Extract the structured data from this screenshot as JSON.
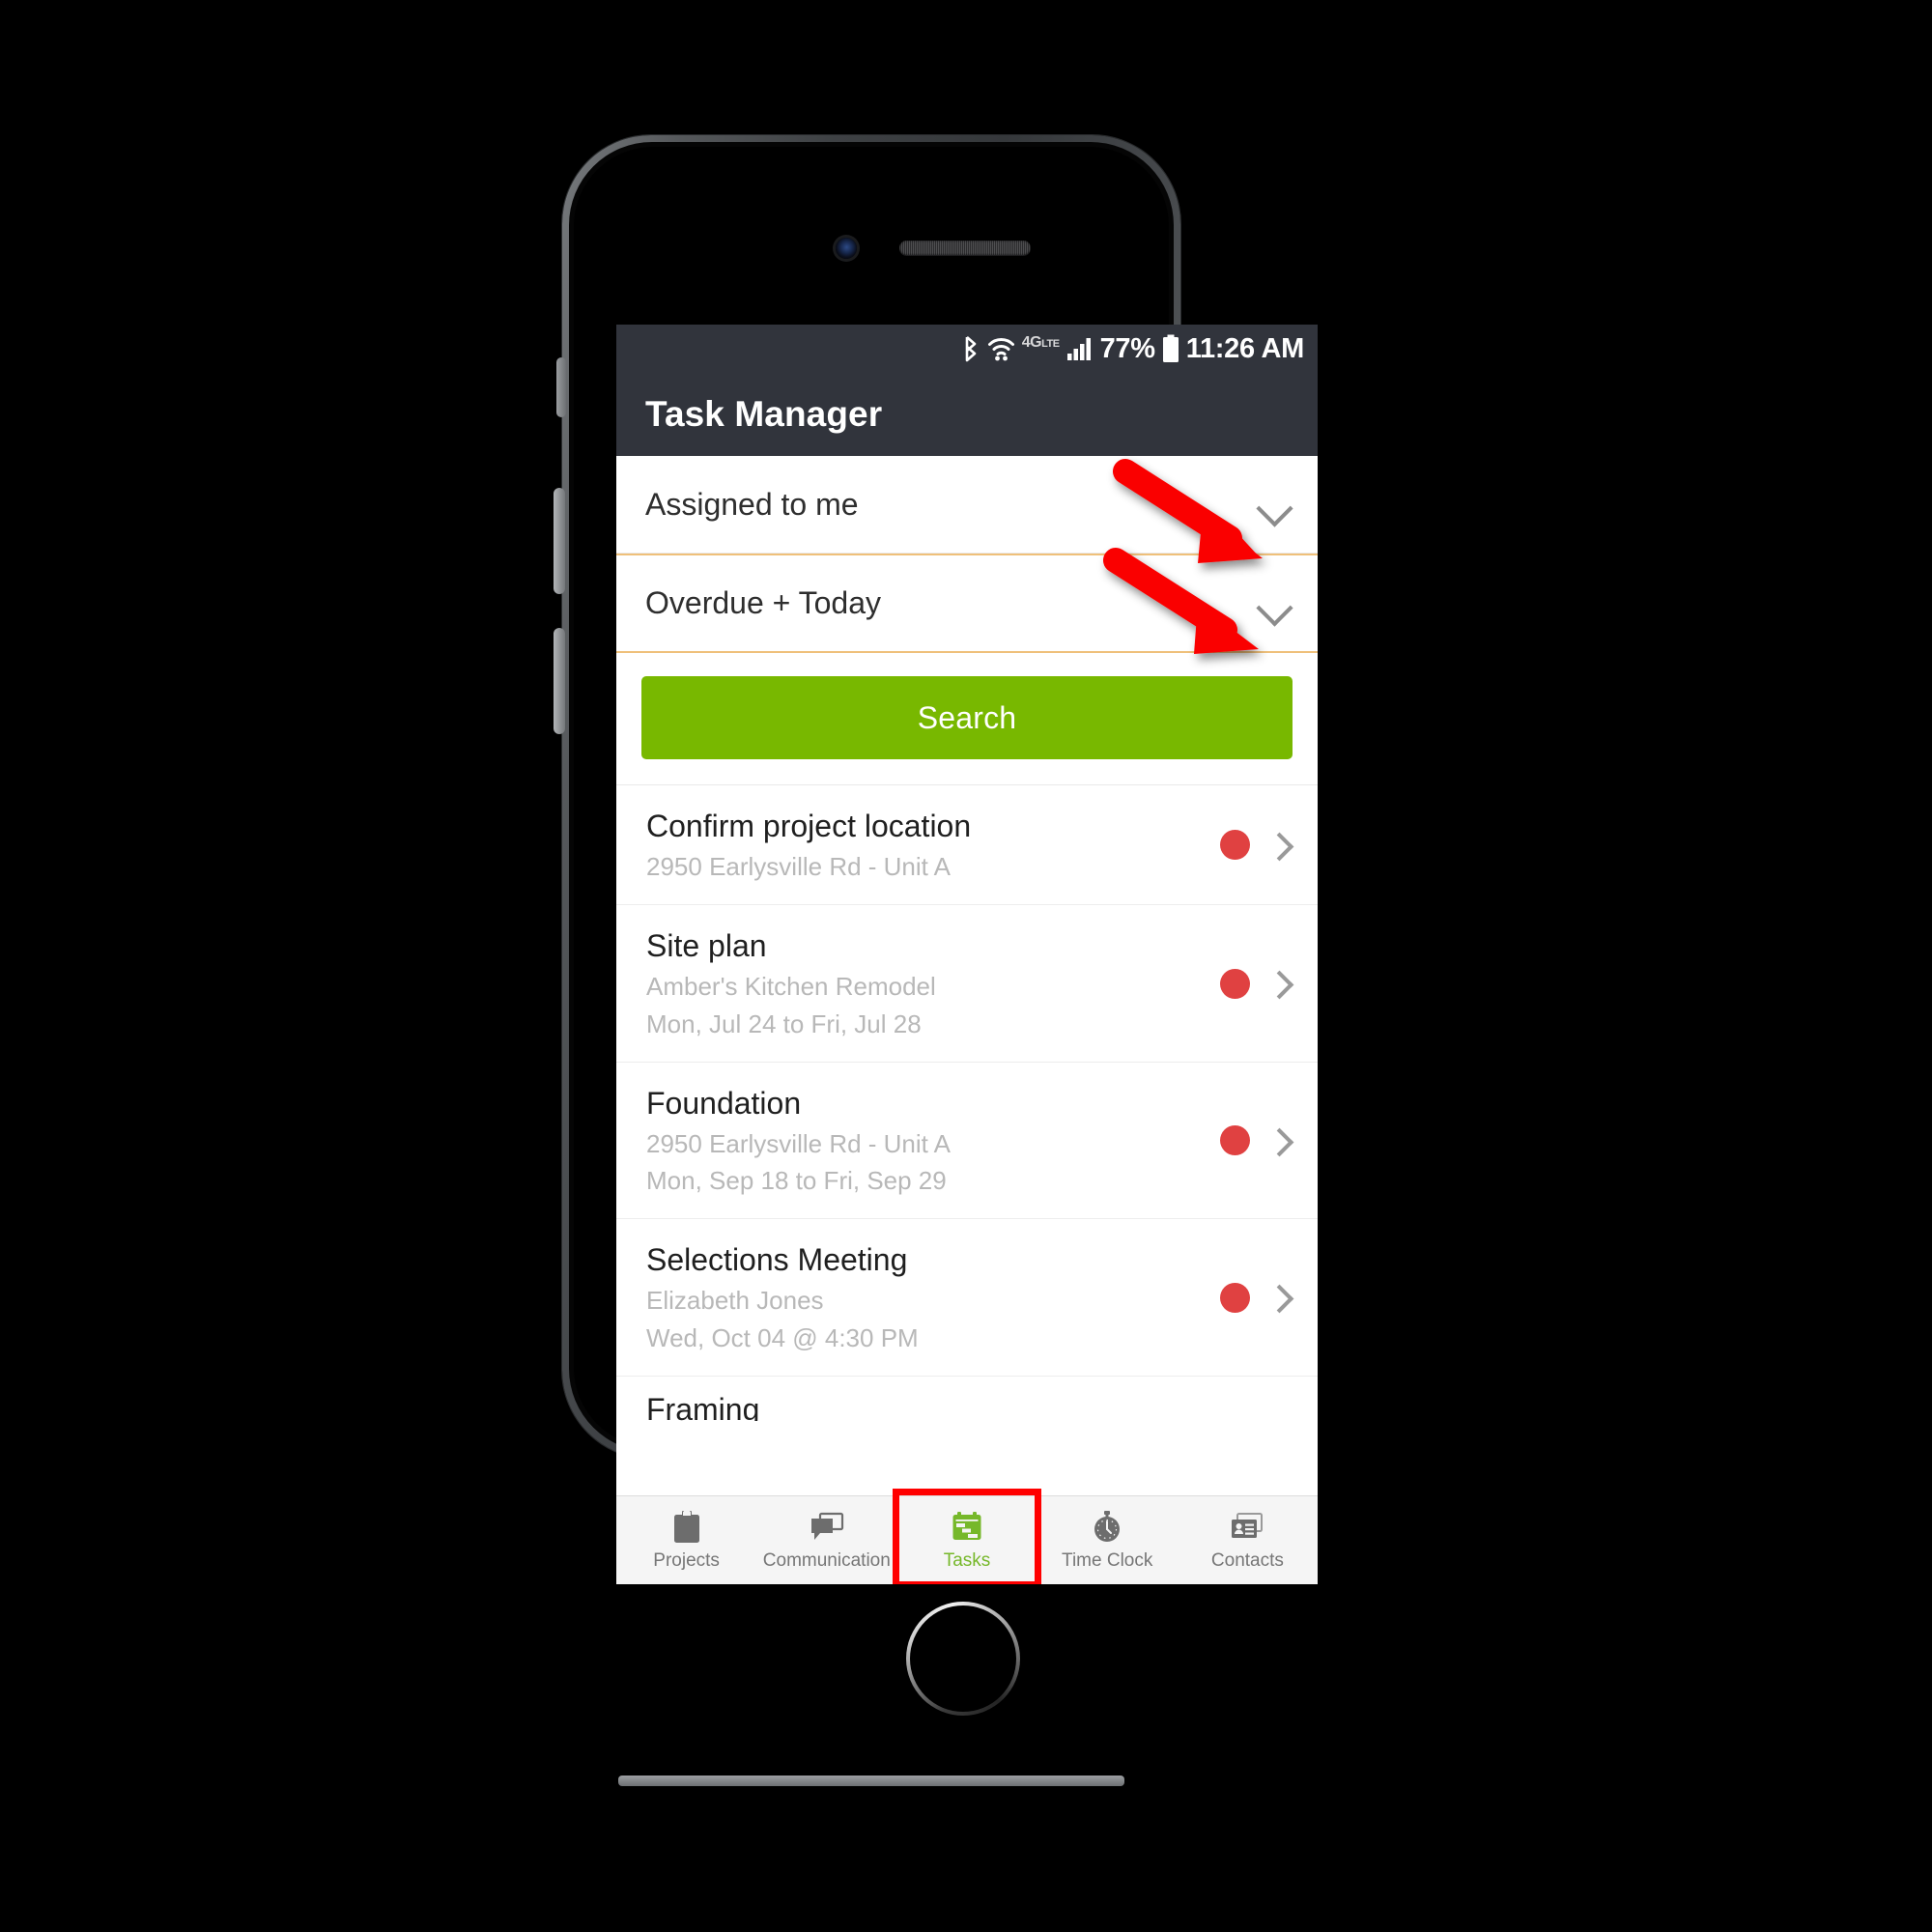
{
  "statusbar": {
    "bluetooth_icon": "bluetooth-icon",
    "wifi_icon": "wifi-icon",
    "network_label": "4G",
    "network_suffix": "LTE",
    "signal_icon": "cellular-signal-icon",
    "battery_percent": "77%",
    "battery_icon": "battery-icon",
    "time": "11:26 AM"
  },
  "appbar": {
    "title": "Task Manager"
  },
  "filters": [
    {
      "label": "Assigned to me",
      "icon": "chevron-down-icon",
      "highlighted": false
    },
    {
      "label": "Overdue + Today",
      "icon": "chevron-down-icon",
      "highlighted": true
    }
  ],
  "search": {
    "label": "Search",
    "color": "#78b800"
  },
  "tasks": [
    {
      "title": "Confirm project location",
      "lines": [
        "2950 Earlysville Rd - Unit A"
      ],
      "status_color": "#e04141",
      "chevron": "chevron-right-icon"
    },
    {
      "title": "Site plan",
      "lines": [
        "Amber's Kitchen Remodel",
        "Mon, Jul 24 to Fri, Jul 28"
      ],
      "status_color": "#e04141",
      "chevron": "chevron-right-icon"
    },
    {
      "title": "Foundation",
      "lines": [
        "2950 Earlysville Rd - Unit A",
        "Mon, Sep 18 to Fri, Sep 29"
      ],
      "status_color": "#e04141",
      "chevron": "chevron-right-icon"
    },
    {
      "title": "Selections Meeting",
      "lines": [
        "Elizabeth Jones",
        "Wed, Oct 04 @ 4:30 PM"
      ],
      "status_color": "#e04141",
      "chevron": "chevron-right-icon"
    }
  ],
  "partial_task": {
    "title": "Framing"
  },
  "bottomnav": {
    "active_index": 2,
    "active_color": "#76b82a",
    "highlight_color": "#ff0000",
    "items": [
      {
        "label": "Projects",
        "icon": "clipboard-icon"
      },
      {
        "label": "Communication",
        "icon": "chat-bubbles-icon"
      },
      {
        "label": "Tasks",
        "icon": "gantt-calendar-icon"
      },
      {
        "label": "Time Clock",
        "icon": "stopwatch-icon"
      },
      {
        "label": "Contacts",
        "icon": "contact-card-icon"
      }
    ]
  },
  "annotations": {
    "color": "#fa0000",
    "arrows": [
      {
        "name": "arrow-to-assigned-to-me-chevron"
      },
      {
        "name": "arrow-to-overdue-today-chevron"
      }
    ]
  }
}
